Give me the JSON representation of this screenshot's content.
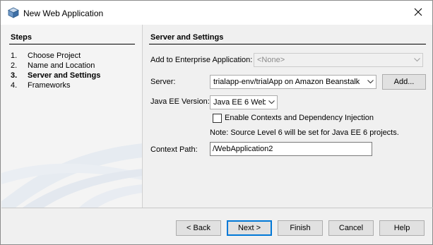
{
  "window": {
    "title": "New Web Application"
  },
  "steps": {
    "title": "Steps",
    "items": [
      {
        "num": "1.",
        "label": "Choose Project",
        "active": false
      },
      {
        "num": "2.",
        "label": "Name and Location",
        "active": false
      },
      {
        "num": "3.",
        "label": "Server and Settings",
        "active": true
      },
      {
        "num": "4.",
        "label": "Frameworks",
        "active": false
      }
    ]
  },
  "main": {
    "title": "Server and Settings",
    "enterprise_label": "Add to Enterprise Application:",
    "enterprise_value": "<None>",
    "server_label": "Server:",
    "server_value": "trialapp-env/trialApp on Amazon Beanstalk",
    "add_label": "Add...",
    "javaee_label": "Java EE Version:",
    "javaee_value": "Java EE 6 Web",
    "cdi_label": "Enable Contexts and Dependency Injection",
    "cdi_checked": false,
    "note": "Note: Source Level 6 will be set for Java EE 6 projects.",
    "context_label": "Context Path:",
    "context_value": "/WebApplication2"
  },
  "buttons": {
    "back": "< Back",
    "next": "Next >",
    "finish": "Finish",
    "cancel": "Cancel",
    "help": "Help"
  },
  "icons": {
    "app": "netbeans-cube-icon",
    "close": "close-icon",
    "dropdown": "chevron-down-icon"
  },
  "colors": {
    "default_button_border": "#0078d7",
    "dialog_bg": "#f0f0f0",
    "titlebar_bg": "#ffffff"
  }
}
